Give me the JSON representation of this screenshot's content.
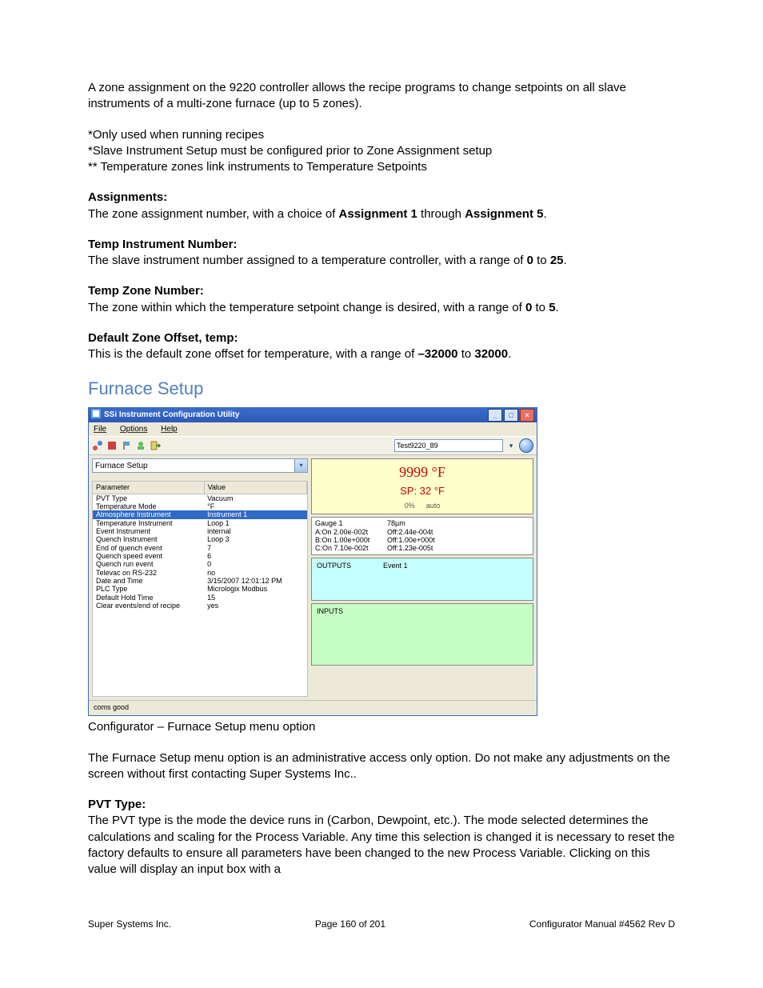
{
  "intro_para": "A zone assignment on the 9220 controller allows the recipe programs to change setpoints on all slave instruments of a multi-zone furnace (up to 5 zones).",
  "notes": [
    "*Only used when running recipes",
    "*Slave Instrument Setup must be configured prior to Zone Assignment setup",
    "** Temperature zones link instruments to Temperature Setpoints"
  ],
  "sections": {
    "assignments": {
      "label": "Assignments:",
      "text_a": "The zone assignment number, with a choice of ",
      "bold_a": "Assignment 1",
      "mid": " through ",
      "bold_b": "Assignment 5",
      "end": "."
    },
    "temp_instr": {
      "label": "Temp Instrument Number:",
      "text_a": "The slave instrument number assigned to a temperature controller, with a range of ",
      "bold_a": "0",
      "mid": " to ",
      "bold_b": "25",
      "end": "."
    },
    "temp_zone": {
      "label": "Temp Zone Number:",
      "text_a": "The zone within which the temperature setpoint change is desired, with a range of ",
      "bold_a": "0",
      "mid": " to ",
      "bold_b": "5",
      "end": "."
    },
    "default_offset": {
      "label": "Default Zone Offset, temp:",
      "text_a": "This is the default zone offset for temperature, with a range of ",
      "bold_a": "–32000",
      "mid": " to ",
      "bold_b": "32000",
      "end": "."
    },
    "pvt": {
      "label": "PVT Type:",
      "text": "The PVT type is the mode the device runs in (Carbon, Dewpoint, etc.). The mode selected determines the calculations and scaling for the Process Variable. Any time this selection is changed it is necessary to reset the factory defaults to ensure all parameters have been changed to the new Process Variable.  Clicking on this value will display an input box with a"
    }
  },
  "furnace_heading": "Furnace Setup",
  "app": {
    "title": "SSi Instrument Configuration Utility",
    "menus": {
      "file": "File",
      "options": "Options",
      "help": "Help"
    },
    "toolbar_combo": "Test9220_89",
    "dropdown": "Furnace Setup",
    "columns": {
      "param": "Parameter",
      "value": "Value"
    },
    "rows": [
      {
        "p": "PVT Type",
        "v": "Vacuum"
      },
      {
        "p": "Temperature Mode",
        "v": "°F"
      },
      {
        "p": "Atmosphere Instrument",
        "v": "Instrument 1",
        "selected": true
      },
      {
        "p": "Temperature Instrument",
        "v": "Loop 1"
      },
      {
        "p": "Event Instrument",
        "v": "internal"
      },
      {
        "p": "Quench Instrument",
        "v": "Loop 3"
      },
      {
        "p": "End of quench event",
        "v": "7"
      },
      {
        "p": "Quench speed event",
        "v": "6"
      },
      {
        "p": "Quench run event",
        "v": "0"
      },
      {
        "p": "Televac on RS-232",
        "v": "no"
      },
      {
        "p": "Date and Time",
        "v": "3/15/2007 12:01:12 PM"
      },
      {
        "p": "PLC Type",
        "v": "Micrologix Modbus"
      },
      {
        "p": "Default Hold Time",
        "v": "15"
      },
      {
        "p": "Clear events/end of recipe",
        "v": "yes"
      }
    ],
    "temp_panel": {
      "value": "9999 °F",
      "sp": "SP: 32 °F",
      "pct": "0%",
      "mode": "auto"
    },
    "gauge": {
      "title": "Gauge 1",
      "title_r": "78µm",
      "a_l": "A:On 2.00e-002t",
      "a_r": "Off:2.44e-004t",
      "b_l": "B:On 1.00e+000t",
      "b_r": "Off:1.00e+000t",
      "c_l": "C:On 7.10e-002t",
      "c_r": "Off:1.23e-005t"
    },
    "outputs": {
      "label": "OUTPUTS",
      "event": "Event 1"
    },
    "inputs": {
      "label": "INPUTS"
    },
    "status": "coms good"
  },
  "caption": "Configurator – Furnace Setup menu option",
  "furnace_para": "The Furnace Setup menu option is an administrative access only option.  Do not make any adjustments on the screen without first contacting Super Systems Inc..",
  "footer": {
    "left": "Super Systems Inc.",
    "center": "Page 160 of 201",
    "right": "Configurator Manual #4562 Rev D"
  }
}
